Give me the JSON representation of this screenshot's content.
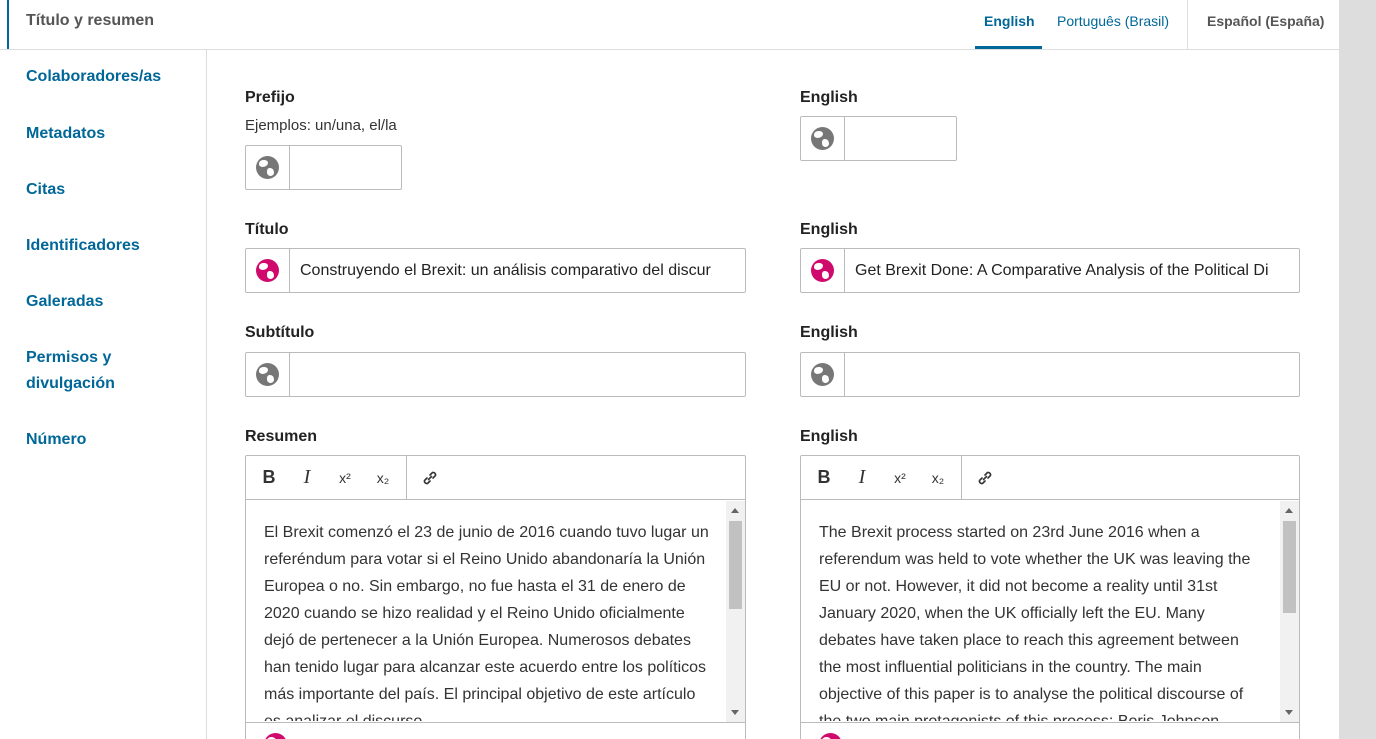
{
  "header": {
    "title": "Título y resumen",
    "tabs": [
      {
        "label": "English",
        "active": true
      },
      {
        "label": "Português (Brasil)",
        "active": false
      },
      {
        "label": "Español (España)",
        "active": false
      }
    ]
  },
  "sidebar": {
    "items": [
      {
        "label": "Colaboradores/as"
      },
      {
        "label": "Metadatos"
      },
      {
        "label": "Citas"
      },
      {
        "label": "Identificadores"
      },
      {
        "label": "Galeradas"
      },
      {
        "label": "Permisos y divulgación"
      },
      {
        "label": "Número"
      }
    ]
  },
  "form": {
    "prefix": {
      "label": "Prefijo",
      "description": "Ejemplos: un/una, el/la",
      "value": "",
      "en_label": "English",
      "en_value": ""
    },
    "title": {
      "label": "Título",
      "value": "Construyendo el Brexit: un análisis comparativo del discur",
      "en_label": "English",
      "en_value": "Get Brexit Done: A Comparative Analysis of the Political Di"
    },
    "subtitle": {
      "label": "Subtítulo",
      "value": "",
      "en_label": "English",
      "en_value": ""
    },
    "abstract": {
      "label": "Resumen",
      "en_label": "English",
      "toolbar": {
        "bold": "B",
        "italic": "I",
        "superscript": "x²",
        "subscript": "x₂"
      },
      "value": "El Brexit comenzó el 23 de junio de 2016 cuando tuvo lugar un referéndum para votar si el Reino Unido abandonaría la Unión Europea o no. Sin embargo, no fue hasta el 31 de enero de 2020 cuando se hizo realidad y el Reino Unido oficialmente dejó de pertenecer a la Unión Europea. Numerosos debates han tenido lugar para alcanzar este acuerdo entre los políticos más importante del país. El principal objetivo de este artículo es analizar el discurso",
      "en_value": "The Brexit process started on 23rd June 2016 when a referendum was held to vote whether the UK was leaving the EU or not. However, it did not become a reality until 31st January 2020, when the UK officially left the EU. Many debates have taken place to reach this agreement between the most influential politicians in the country. The main objective of this paper is to analyse the political discourse of the two main protagonists of this process: Boris Johnson"
    }
  },
  "colors": {
    "primary": "#006798",
    "locale_filled": "#d00a6c",
    "locale_empty": "#777777"
  }
}
